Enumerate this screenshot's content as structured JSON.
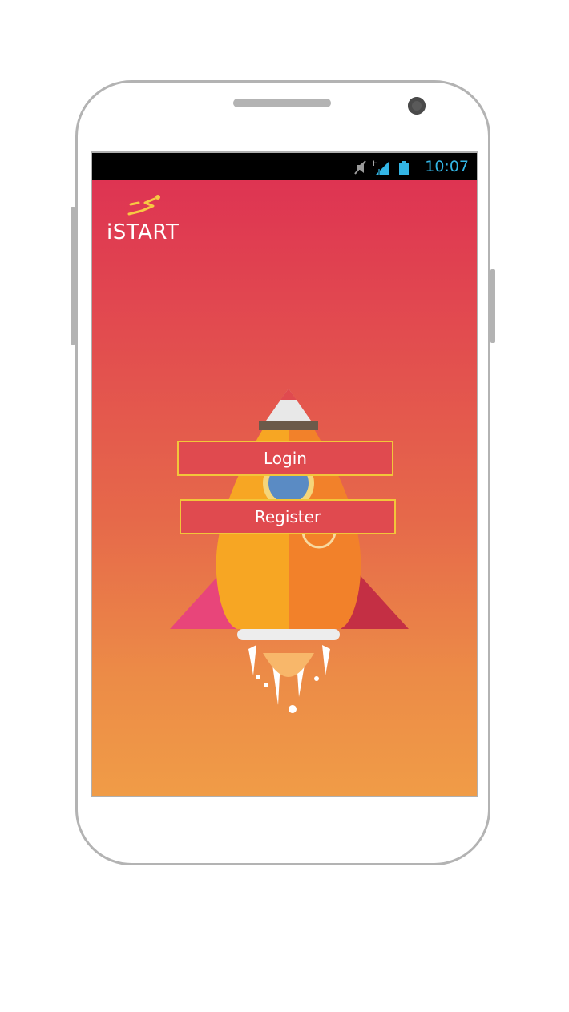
{
  "status_bar": {
    "time": "10:07",
    "icons": [
      "mute-icon",
      "signal-h-icon",
      "battery-icon"
    ],
    "time_color": "#33b5e5"
  },
  "app": {
    "logo_text": "iSTART",
    "colors": {
      "gradient_top": "#de3452",
      "gradient_bottom": "#f09c47",
      "button_fill": "#e04a4f",
      "button_border": "#f2c63a"
    }
  },
  "actions": {
    "login_label": "Login",
    "register_label": "Register"
  }
}
